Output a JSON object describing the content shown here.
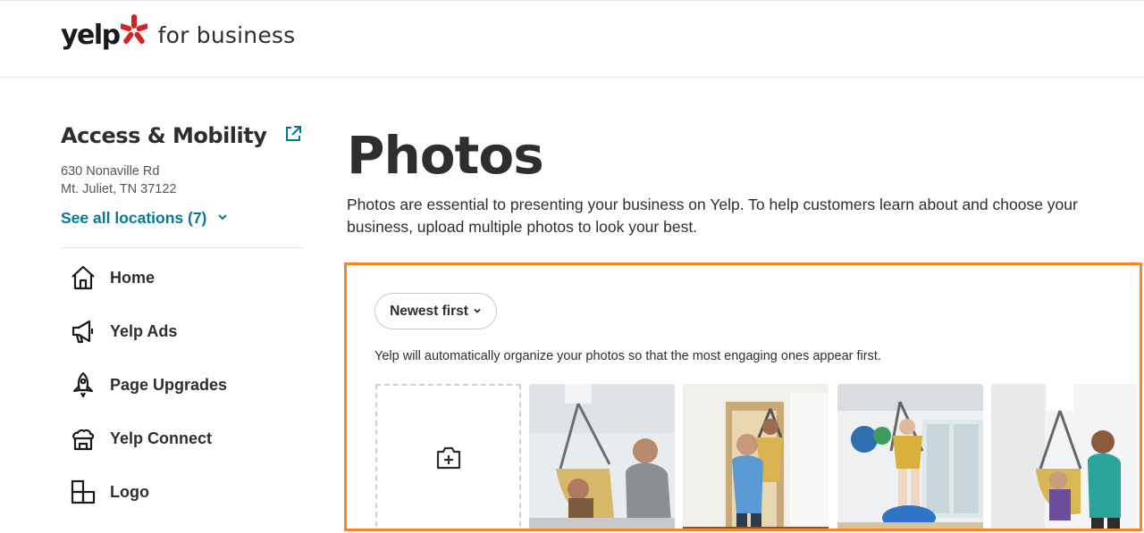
{
  "header": {
    "logo_word": "yelp",
    "logo_suffix": "for business"
  },
  "business": {
    "name": "Access & Mobility",
    "address_line1": "630 Nonaville Rd",
    "address_line2": "Mt. Juliet, TN 37122",
    "see_all_locations": "See all locations (7)"
  },
  "nav": {
    "items": [
      {
        "label": "Home",
        "icon": "home-icon"
      },
      {
        "label": "Yelp Ads",
        "icon": "megaphone-icon"
      },
      {
        "label": "Page Upgrades",
        "icon": "rocket-icon"
      },
      {
        "label": "Yelp Connect",
        "icon": "connect-storefront-icon"
      },
      {
        "label": "Logo",
        "icon": "logo-blocks-icon"
      }
    ]
  },
  "main": {
    "title": "Photos",
    "description": "Photos are essential to presenting your business on Yelp. To help customers learn about and choose your business, upload multiple photos to look your best."
  },
  "photos": {
    "sort_label": "Newest first",
    "note": "Yelp will automatically organize your photos so that the most engaging ones appear first.",
    "upload_icon": "add-photo-camera-icon",
    "tiles": [
      {
        "name": "photo-tile-1"
      },
      {
        "name": "photo-tile-2"
      },
      {
        "name": "photo-tile-3"
      },
      {
        "name": "photo-tile-4"
      }
    ]
  },
  "colors": {
    "brand_red": "#d32323",
    "link_teal": "#027a97",
    "highlight_orange": "#f58727"
  }
}
